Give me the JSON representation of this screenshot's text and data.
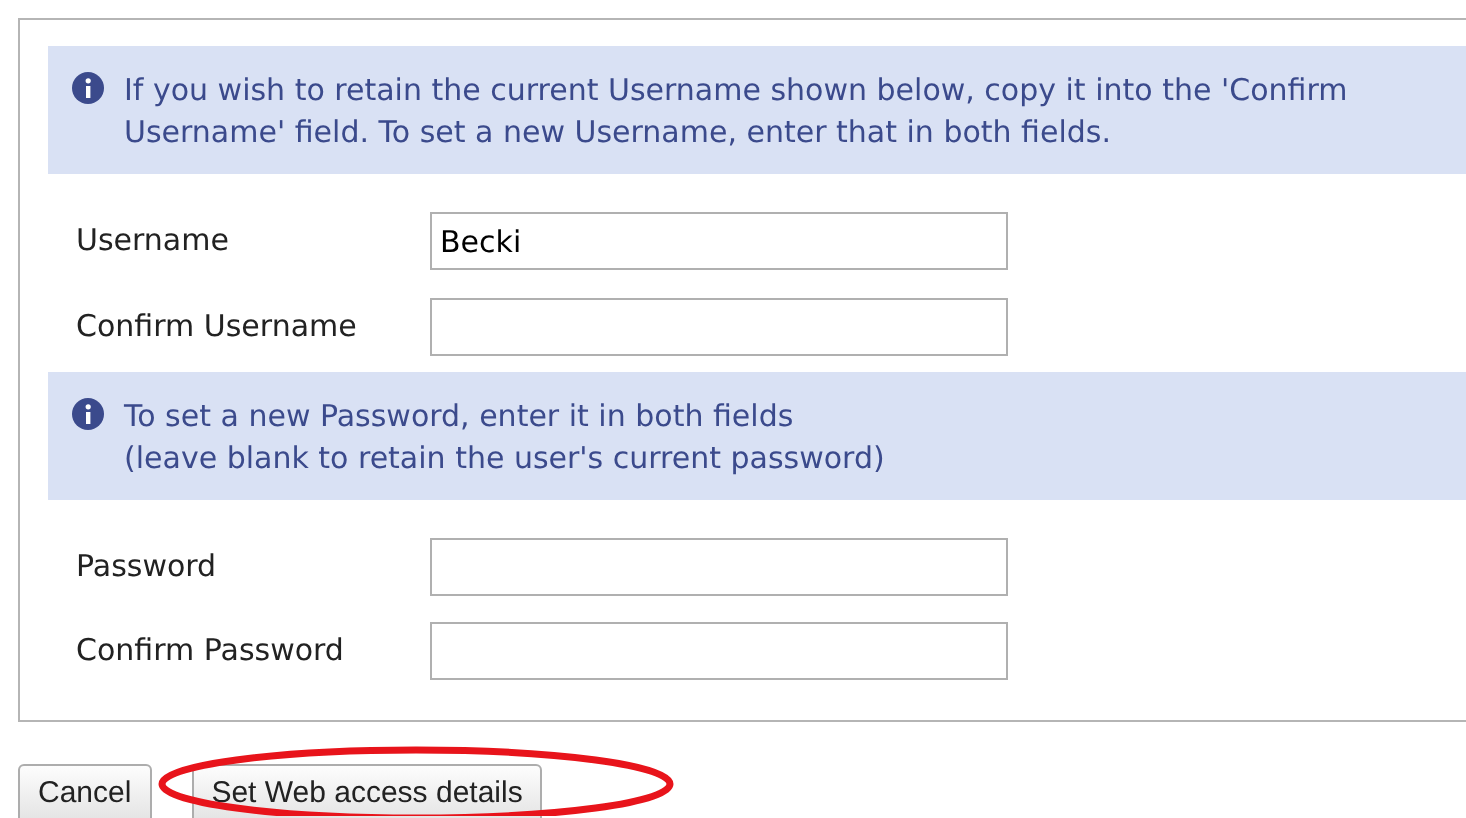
{
  "notices": [
    {
      "text": "If you wish to retain the current Username shown below, copy it into the 'Confirm Username' field. To set a new Username, enter that in both fields."
    },
    {
      "text": "To set a new Password, enter it in both fields\n(leave blank to retain the user's current password)"
    }
  ],
  "username_fields": [
    {
      "label": "Username",
      "value": "Becki"
    },
    {
      "label": "Confirm Username"
    }
  ],
  "password_fields": [
    {
      "label": "Password"
    },
    {
      "label": "Confirm Password"
    }
  ],
  "buttons": [
    {
      "label": "Cancel",
      "highlighted": false
    },
    {
      "label": "Set Web access details",
      "highlighted": true
    }
  ]
}
